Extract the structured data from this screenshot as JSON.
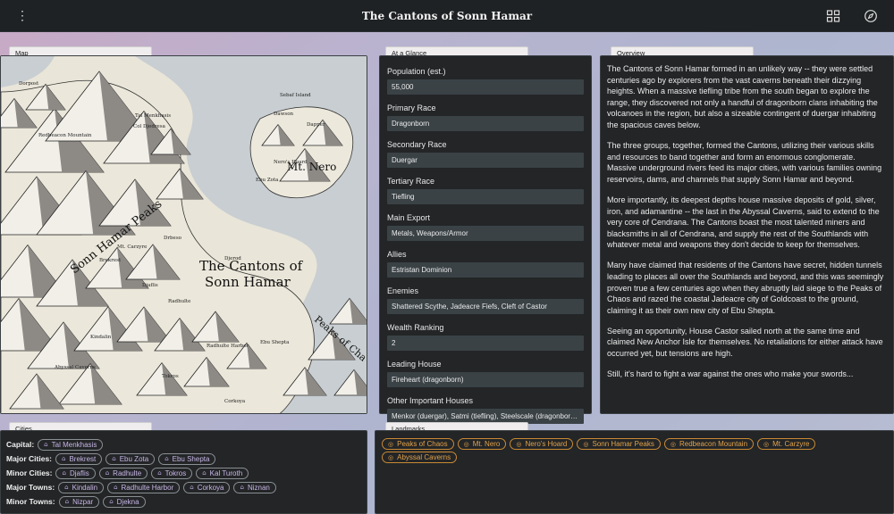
{
  "app": {
    "title": "The Cantons of Sonn Hamar",
    "menu_icon": "more-vertical-icon",
    "grid_icon": "grid-layout-icon",
    "compass_icon": "compass-icon"
  },
  "tabs": {
    "map": "Map",
    "glance": "At a Glance",
    "overview": "Overview",
    "cities": "Cities",
    "landmarks": "Landmarks"
  },
  "map_labels": {
    "title_line1": "The Cantons of",
    "title_line2": "Sonn Hamar",
    "peaks": "Sonn Hamar Peaks",
    "mt_nero": "Mt. Nero",
    "peaks_of_chaos": "Peaks of Cha",
    "places": [
      "Redbeacon Mountain",
      "Tal Menkhasis",
      "Col Djedresa",
      "Dawson",
      "Djaflis",
      "Mt. Carzyre",
      "Brekrest",
      "Radhulte",
      "Radhulte Harbor",
      "Ebu Shepta",
      "Tokros",
      "Ebu Zota",
      "Kindalin",
      "Corkoya",
      "Abyssal Caverns",
      "Drbeso",
      "Dapper",
      "Nero's Hoard",
      "Sebaf Island",
      "Dorpost",
      "Djerod"
    ]
  },
  "glance": [
    {
      "label": "Population (est.)",
      "value": "55,000"
    },
    {
      "label": "Primary Race",
      "value": "Dragonborn"
    },
    {
      "label": "Secondary Race",
      "value": "Duergar"
    },
    {
      "label": "Tertiary Race",
      "value": "Tiefling"
    },
    {
      "label": "Main Export",
      "value": "Metals, Weapons/Armor"
    },
    {
      "label": "Allies",
      "value": "Estristan Dominion"
    },
    {
      "label": "Enemies",
      "value": "Shattered Scythe, Jadeacre Fiefs, Cleft of Castor"
    },
    {
      "label": "Wealth Ranking",
      "value": "2"
    },
    {
      "label": "Leading House",
      "value": "Fireheart (dragonborn)"
    },
    {
      "label": "Other Important Houses",
      "value": "Menkor (duergar), Satmi (tiefling), Steelscale (dragonborn), ..."
    }
  ],
  "overview": [
    "The Cantons of Sonn Hamar formed in an unlikely way -- they were settled centuries ago by explorers from the vast caverns beneath their dizzying heights. When a massive tiefling tribe from the south began to explore the range, they discovered not only a handful of dragonborn clans inhabiting the volcanoes in the region, but also a sizeable contingent of duergar inhabiting the spacious caves below.",
    "The three groups, together, formed the Cantons, utilizing their various skills and resources to band together and form an enormous conglomerate. Massive underground rivers feed its major cities, with various families owning reservoirs, dams, and channels that supply Sonn Hamar and beyond.",
    "More importantly, its deepest depths house massive deposits of gold, silver, iron, and adamantine -- the last in the Abyssal Caverns, said to extend to the very core of Cendrana. The Cantons boast the most talented miners and blacksmiths in all of Cendrana, and supply the rest of the Southlands with whatever metal and weapons they don't decide to keep for themselves.",
    "Many have claimed that residents of the Cantons have secret, hidden tunnels leading to places all over the Southlands and beyond, and this was seemingly proven true a few centuries ago when they abruptly laid siege to the Peaks of Chaos and razed the coastal Jadeacre city of Goldcoast to the ground, claiming it as their own new city of Ebu Shepta.",
    "Seeing an opportunity, House Castor sailed north at the same time and claimed New Anchor Isle for themselves. No retaliations for either attack have occurred yet, but tensions are high.",
    "Still, it's hard to fight a war against the ones who make your swords..."
  ],
  "cities": {
    "capital": {
      "label": "Capital:",
      "items": [
        "Tal Menkhasis"
      ]
    },
    "major_cities": {
      "label": "Major Cities:",
      "items": [
        "Brekrest",
        "Ebu Zota",
        "Ebu Shepta"
      ]
    },
    "minor_cities": {
      "label": "Minor Cities:",
      "items": [
        "Djaflis",
        "Radhulte",
        "Tokros",
        "Kal Turoth"
      ]
    },
    "major_towns": {
      "label": "Major Towns:",
      "items": [
        "Kindalin",
        "Radhulte Harbor",
        "Corkoya",
        "Niznan"
      ]
    },
    "minor_towns": {
      "label": "Minor Towns:",
      "items": [
        "Nizpar",
        "Djekna"
      ]
    },
    "city_icon": "building-columns-icon"
  },
  "landmarks": {
    "items": [
      "Peaks of Chaos",
      "Mt. Nero",
      "Nero's Hoard",
      "Sonn Hamar Peaks",
      "Redbeacon Mountain",
      "Mt. Carzyre",
      "Abyssal Caverns"
    ],
    "icon": "compass-icon",
    "color": "#e2a24a"
  }
}
